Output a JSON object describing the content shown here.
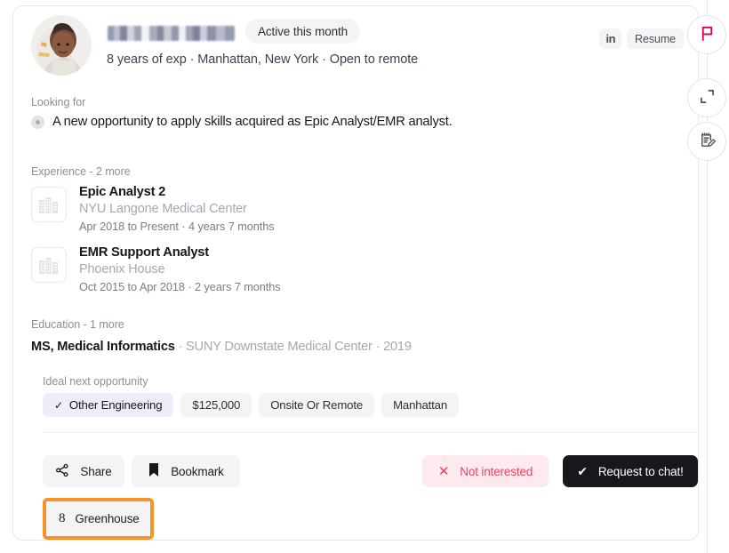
{
  "header": {
    "avatar_alt": "candidate-photo",
    "name_redacted": true,
    "active_badge": "Active this month",
    "subline": "8 years of exp · Manhattan, New York · Open to remote",
    "linkedin_label": "in",
    "resume_label": "Resume"
  },
  "looking_for": {
    "label": "Looking for",
    "text": "A new opportunity to apply skills acquired as Epic Analyst/EMR analyst."
  },
  "experience": {
    "label": "Experience - 2 more",
    "items": [
      {
        "title": "Epic Analyst 2",
        "company": "NYU Langone Medical Center",
        "dates": "Apr 2018 to Present · 4 years 7 months"
      },
      {
        "title": "EMR Support Analyst",
        "company": "Phoenix House",
        "dates": "Oct 2015 to Apr 2018 · 2 years 7 months"
      }
    ]
  },
  "education": {
    "label": "Education - 1 more",
    "degree": "MS, Medical Informatics",
    "rest": " · SUNY Downstate Medical Center · 2019"
  },
  "ideal": {
    "label": "Ideal next opportunity",
    "tags": [
      {
        "text": "Other Engineering",
        "selected": true,
        "check": "✓"
      },
      {
        "text": "$125,000",
        "selected": false
      },
      {
        "text": "Onsite Or Remote",
        "selected": false
      },
      {
        "text": "Manhattan",
        "selected": false
      }
    ]
  },
  "actions": {
    "share": "Share",
    "bookmark": "Bookmark",
    "not_interested": "Not interested",
    "not_interested_mark": "✕",
    "request_chat": "Request to chat!",
    "request_chat_mark": "✔",
    "greenhouse": "Greenhouse",
    "greenhouse_glyph": "8"
  },
  "rail": {
    "flag": "flag-icon",
    "expand": "expand-icon",
    "notes": "notes-edit-icon"
  },
  "colors": {
    "accent_dark": "#16181c",
    "danger": "#e8425f",
    "danger_bg": "#fdeaee",
    "highlight_orange": "#f59323",
    "tag_selected_bg": "#eeeefb",
    "chip_bg": "#f4f4f5",
    "flag_icon": "#d6005c",
    "muted_text": "#a5a8b2"
  }
}
